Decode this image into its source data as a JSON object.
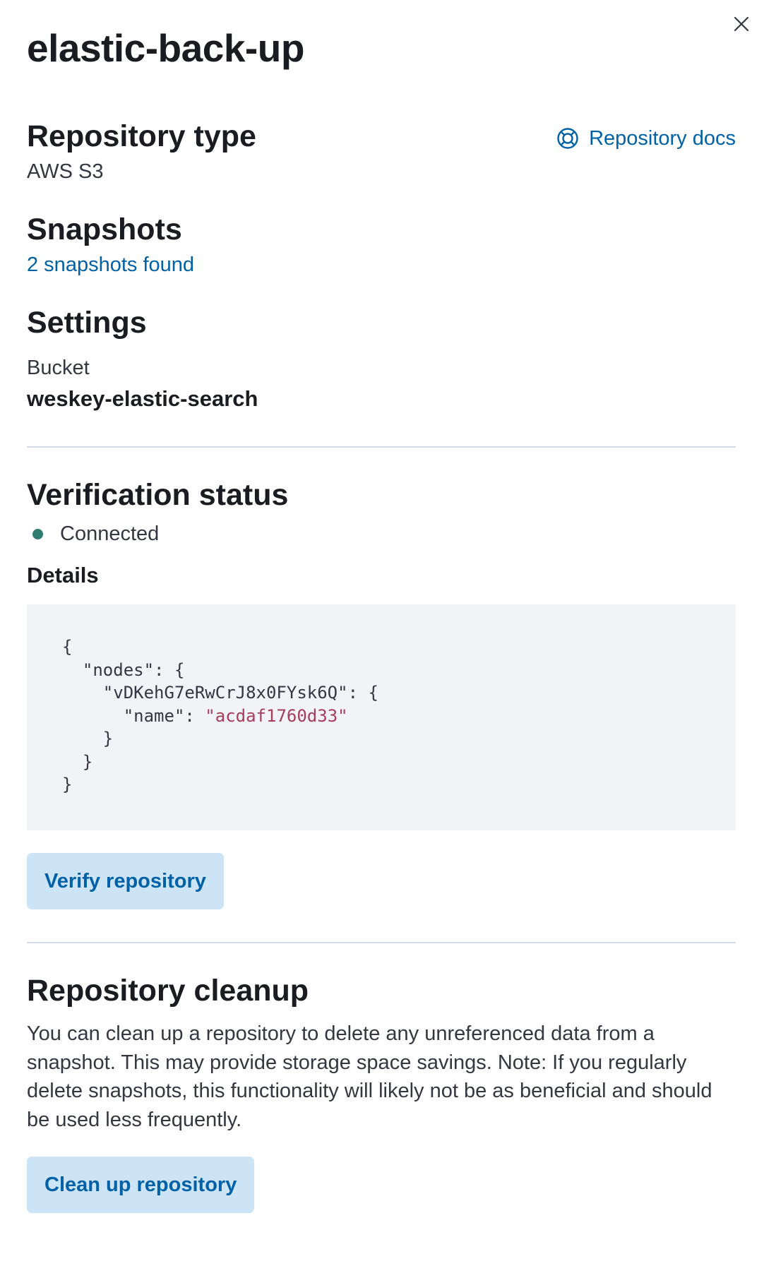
{
  "flyout": {
    "title": "elastic-back-up",
    "close_icon": "close-icon"
  },
  "repository_type": {
    "heading": "Repository type",
    "value": "AWS S3",
    "docs_link": "Repository docs",
    "docs_icon": "help-lifebuoy-icon"
  },
  "snapshots": {
    "heading": "Snapshots",
    "link": "2 snapshots found"
  },
  "settings": {
    "heading": "Settings",
    "label": "Bucket",
    "value": "weskey-elastic-search"
  },
  "verification": {
    "heading": "Verification status",
    "status": "Connected",
    "status_color": "#2e7d6e",
    "details_heading": "Details",
    "details_json": {
      "line1": "{",
      "line2": "  \"nodes\": {",
      "line3": "    \"vDKehG7eRwCrJ8x0FYsk6Q\": {",
      "line4_key": "      \"name\": ",
      "line4_value": "\"acdaf1760d33\"",
      "line5": "    }",
      "line6": "  }",
      "line7": "}"
    },
    "verify_button": "Verify repository"
  },
  "cleanup": {
    "heading": "Repository cleanup",
    "description": "You can clean up a repository to delete any unreferenced data from a snapshot. This may provide storage space savings. Note: If you regularly delete snapshots, this functionality will likely not be as beneficial and should be used less frequently.",
    "button": "Clean up repository"
  },
  "colors": {
    "link": "#0061a6",
    "button_bg": "#cce4f5",
    "code_bg": "#f1f3f6",
    "code_string": "#a63d5b",
    "divider": "#d3dae6"
  }
}
